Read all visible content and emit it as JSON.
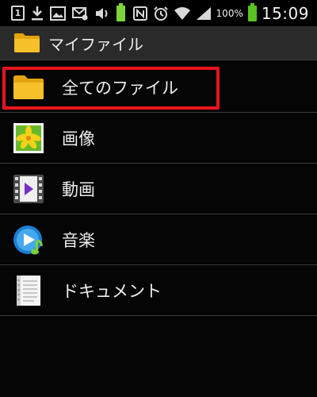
{
  "status_bar": {
    "notification_count": "1",
    "battery_percent": "100%",
    "time": "15:09"
  },
  "action_bar": {
    "title": "マイファイル"
  },
  "list": {
    "items": [
      {
        "label": "全てのファイル",
        "icon": "folder-icon",
        "highlighted": true
      },
      {
        "label": "画像",
        "icon": "image-icon"
      },
      {
        "label": "動画",
        "icon": "video-icon"
      },
      {
        "label": "音楽",
        "icon": "music-icon"
      },
      {
        "label": "ドキュメント",
        "icon": "document-icon"
      }
    ]
  },
  "colors": {
    "highlight": "#e8131b",
    "folder": "#f2b81d",
    "action_bar": "#2a2a2a"
  }
}
